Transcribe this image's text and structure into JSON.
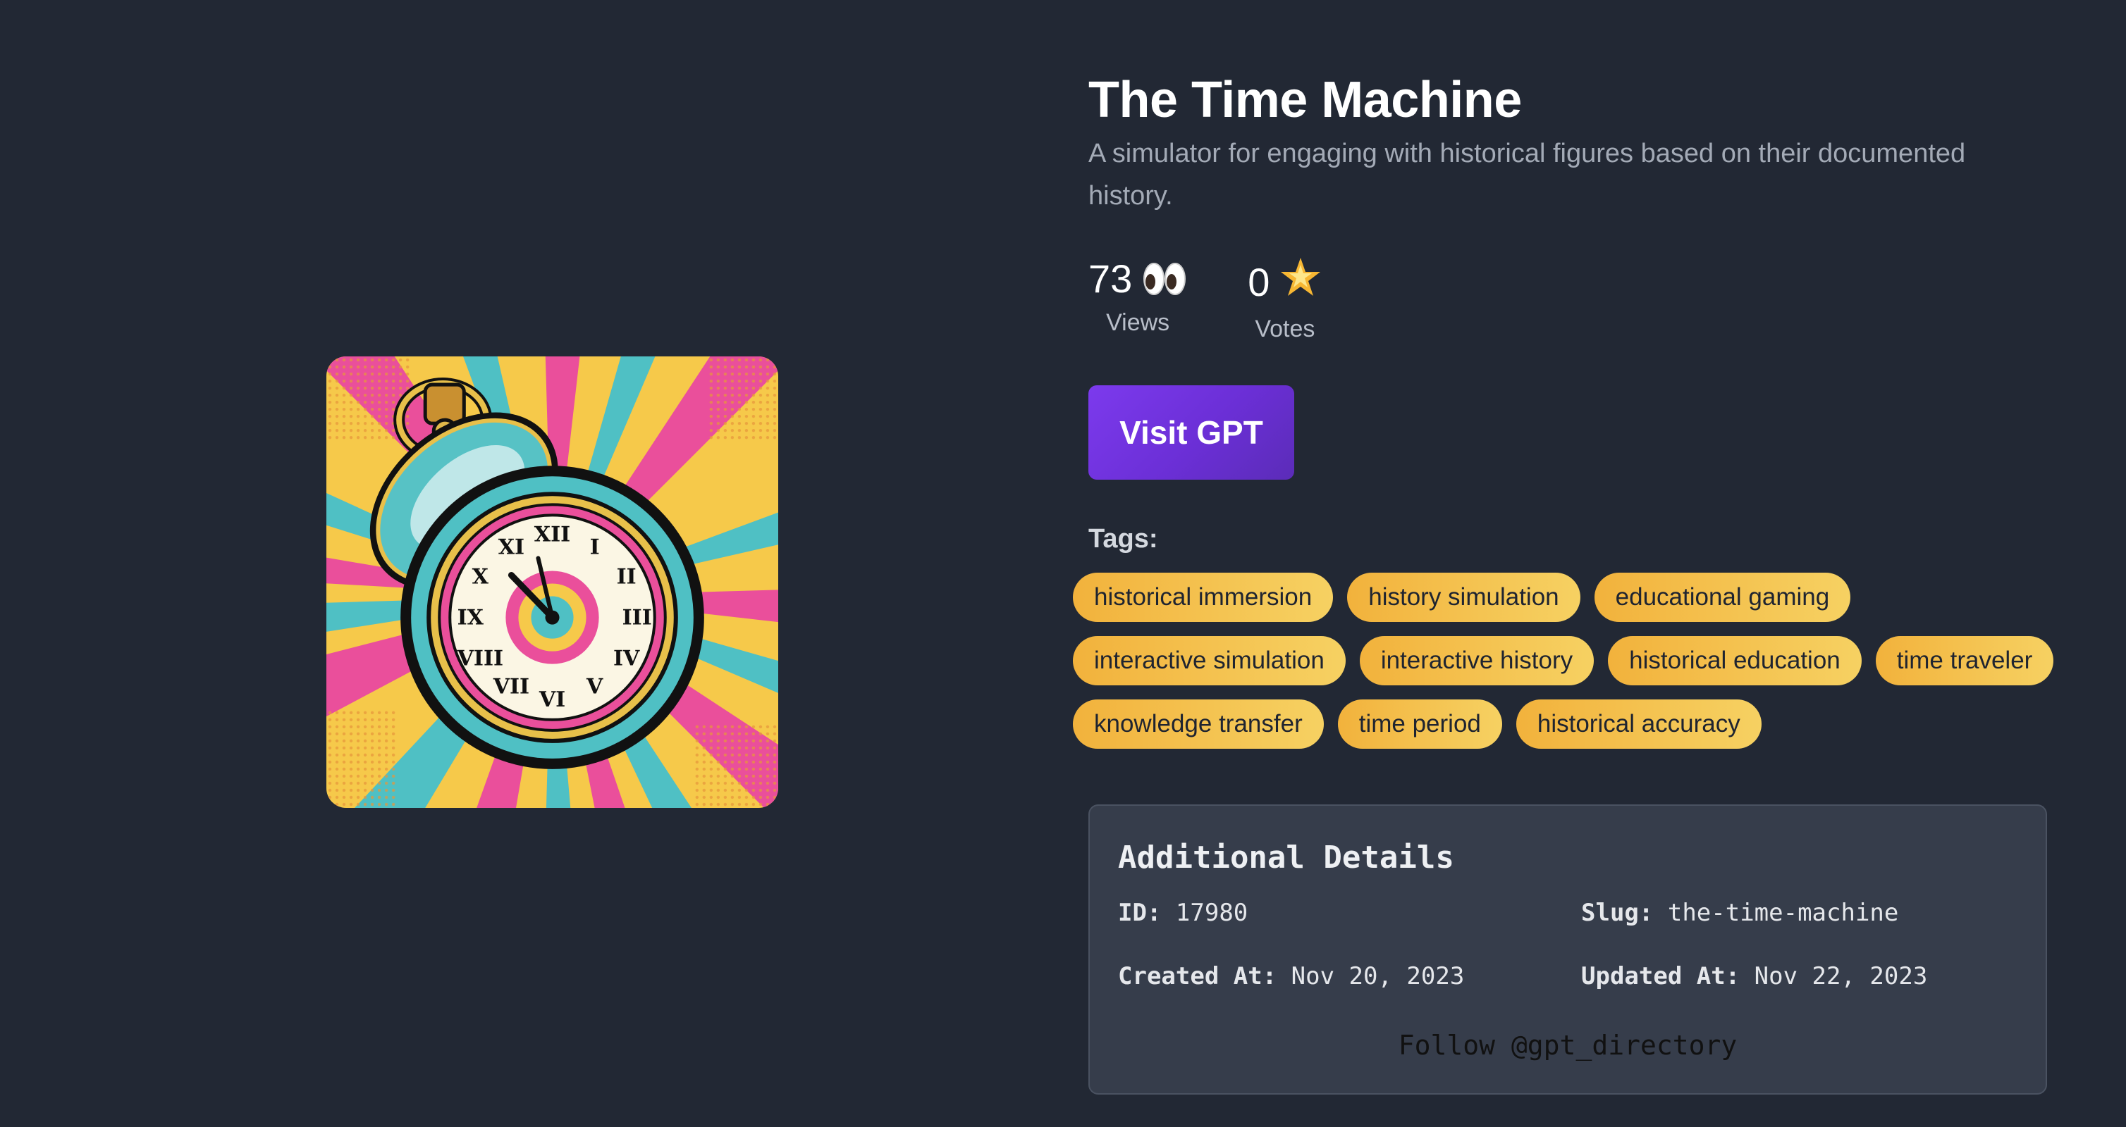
{
  "gpt": {
    "title": "The Time Machine",
    "description": "A simulator for engaging with historical figures based on their documented history."
  },
  "stats": {
    "views_value": "73",
    "views_icon": "eyes-icon",
    "views_label": "Views",
    "votes_value": "0",
    "votes_icon": "star-icon",
    "votes_label": "Votes"
  },
  "visit_button": "Visit GPT",
  "tags_label": "Tags:",
  "tags": [
    "historical immersion",
    "history simulation",
    "educational gaming",
    "interactive simulation",
    "interactive history",
    "historical education",
    "time traveler",
    "knowledge transfer",
    "time period",
    "historical accuracy"
  ],
  "details": {
    "title": "Additional Details",
    "id_label": "ID:",
    "id_value": "17980",
    "slug_label": "Slug:",
    "slug_value": "the-time-machine",
    "created_label": "Created At:",
    "created_value": "Nov 20, 2023",
    "updated_label": "Updated At:",
    "updated_value": "Nov 22, 2023",
    "follow": "Follow @gpt_directory"
  },
  "colors": {
    "background": "#222834",
    "button": "#6b2fd6",
    "tag": "#f4c14d",
    "panel": "#363d4b"
  }
}
